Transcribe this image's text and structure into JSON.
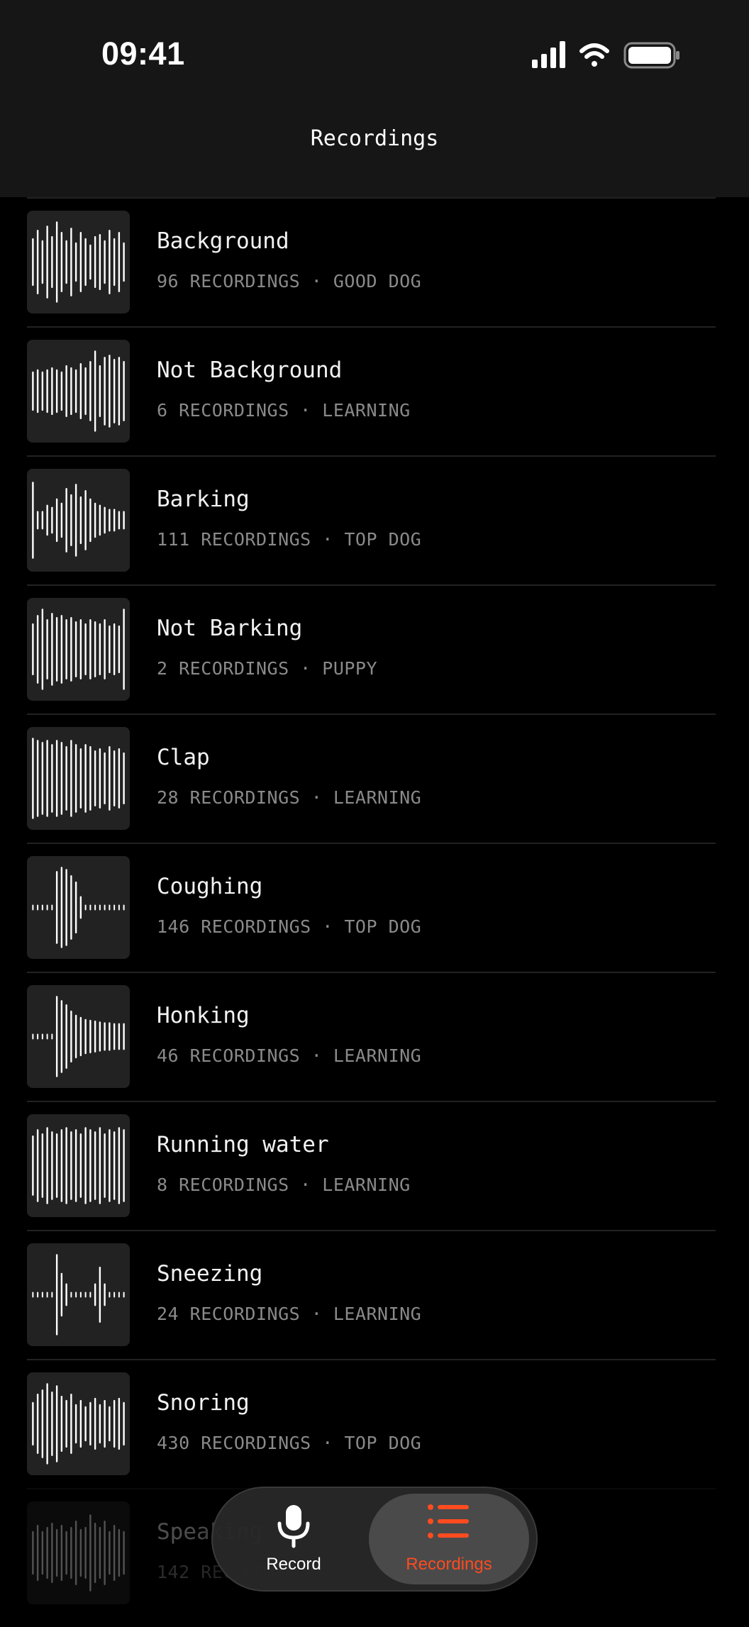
{
  "status_bar": {
    "time": "09:41"
  },
  "nav": {
    "title": "Recordings"
  },
  "recordings": [
    {
      "title": "Background",
      "meta": "96 RECORDINGS · GOOD DOG",
      "wave": [
        0.55,
        0.75,
        0.5,
        0.85,
        0.6,
        0.95,
        0.7,
        0.5,
        0.8,
        0.45,
        0.7,
        0.55,
        0.4,
        0.6,
        0.65,
        0.5,
        0.75,
        0.55,
        0.7,
        0.45
      ]
    },
    {
      "title": "Not Background",
      "meta": "6 RECORDINGS · LEARNING",
      "wave": [
        0.45,
        0.5,
        0.45,
        0.5,
        0.55,
        0.5,
        0.45,
        0.6,
        0.55,
        0.5,
        0.65,
        0.55,
        0.7,
        0.95,
        0.6,
        0.8,
        0.85,
        0.75,
        0.8,
        0.7
      ]
    },
    {
      "title": "Barking",
      "meta": "111 RECORDINGS · TOP DOG",
      "wave": [
        0.9,
        0.2,
        0.2,
        0.35,
        0.3,
        0.5,
        0.4,
        0.75,
        0.6,
        0.85,
        0.55,
        0.7,
        0.5,
        0.4,
        0.35,
        0.3,
        0.25,
        0.25,
        0.2,
        0.2
      ]
    },
    {
      "title": "Not Barking",
      "meta": "2 RECORDINGS · PUPPY",
      "wave": [
        0.6,
        0.8,
        0.95,
        0.7,
        0.85,
        0.75,
        0.8,
        0.7,
        0.75,
        0.65,
        0.7,
        0.6,
        0.7,
        0.65,
        0.6,
        0.7,
        0.55,
        0.6,
        0.55,
        0.95
      ]
    },
    {
      "title": "Clap",
      "meta": "28 RECORDINGS · LEARNING",
      "wave": [
        0.95,
        0.9,
        0.85,
        0.9,
        0.8,
        0.9,
        0.85,
        0.75,
        0.9,
        0.8,
        0.7,
        0.8,
        0.75,
        0.65,
        0.7,
        0.6,
        0.75,
        0.65,
        0.7,
        0.6
      ]
    },
    {
      "title": "Coughing",
      "meta": "146 RECORDINGS · TOP DOG",
      "wave": [
        0.05,
        0.05,
        0.05,
        0.05,
        0.05,
        0.85,
        0.95,
        0.9,
        0.75,
        0.6,
        0.25,
        0.05,
        0.05,
        0.05,
        0.05,
        0.05,
        0.05,
        0.05,
        0.05,
        0.05
      ]
    },
    {
      "title": "Honking",
      "meta": "46 RECORDINGS · LEARNING",
      "wave": [
        0.05,
        0.05,
        0.05,
        0.05,
        0.05,
        0.95,
        0.85,
        0.75,
        0.6,
        0.5,
        0.45,
        0.4,
        0.38,
        0.36,
        0.34,
        0.32,
        0.32,
        0.3,
        0.3,
        0.3
      ]
    },
    {
      "title": "Running water",
      "meta": "8 RECORDINGS · LEARNING",
      "wave": [
        0.7,
        0.85,
        0.75,
        0.9,
        0.8,
        0.75,
        0.85,
        0.9,
        0.8,
        0.85,
        0.75,
        0.9,
        0.85,
        0.8,
        0.9,
        0.75,
        0.85,
        0.8,
        0.9,
        0.85
      ]
    },
    {
      "title": "Sneezing",
      "meta": "24 RECORDINGS · LEARNING",
      "wave": [
        0.05,
        0.05,
        0.05,
        0.05,
        0.05,
        0.95,
        0.5,
        0.25,
        0.05,
        0.05,
        0.05,
        0.05,
        0.05,
        0.25,
        0.65,
        0.25,
        0.05,
        0.05,
        0.05,
        0.05
      ]
    },
    {
      "title": "Snoring",
      "meta": "430 RECORDINGS · TOP DOG",
      "wave": [
        0.5,
        0.7,
        0.8,
        0.95,
        0.75,
        0.9,
        0.65,
        0.55,
        0.7,
        0.45,
        0.55,
        0.4,
        0.5,
        0.6,
        0.45,
        0.55,
        0.4,
        0.55,
        0.6,
        0.5
      ]
    },
    {
      "title": "Speaking",
      "meta": "142 RECORDINGS",
      "wave": [
        0.5,
        0.65,
        0.5,
        0.6,
        0.7,
        0.55,
        0.65,
        0.5,
        0.6,
        0.75,
        0.55,
        0.6,
        0.9,
        0.7,
        0.6,
        0.75,
        0.5,
        0.65,
        0.55,
        0.5
      ]
    }
  ],
  "tab_bar": {
    "record_label": "Record",
    "recordings_label": "Recordings",
    "active_color": "#ff4b1f",
    "record_icon": "microphone-icon",
    "recordings_icon": "list-icon"
  }
}
